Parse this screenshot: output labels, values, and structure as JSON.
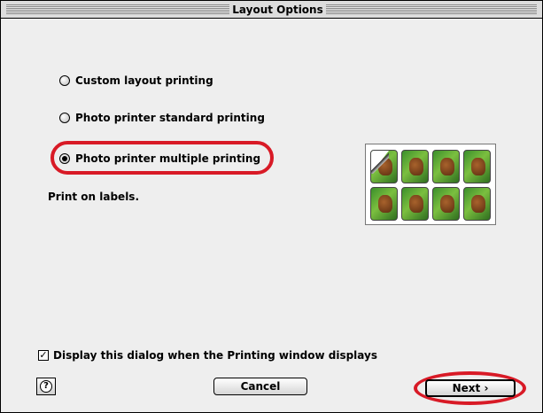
{
  "window": {
    "title": "Layout Options"
  },
  "options": [
    {
      "label": "Custom layout printing",
      "checked": false
    },
    {
      "label": "Photo printer standard printing",
      "checked": false
    },
    {
      "label": "Photo printer multiple printing",
      "checked": true
    }
  ],
  "description": "Print on labels.",
  "preview": {
    "icon": "photo-labels-sheet-icon"
  },
  "footer": {
    "checkbox_label": "Display this dialog when the Printing window displays",
    "checkbox_checked": true,
    "help_icon": "help-icon",
    "help_glyph": "?",
    "cancel_label": "Cancel",
    "next_label": "Next ›"
  },
  "colors": {
    "highlight": "#d81a26",
    "window_bg": "#eeeeee"
  }
}
